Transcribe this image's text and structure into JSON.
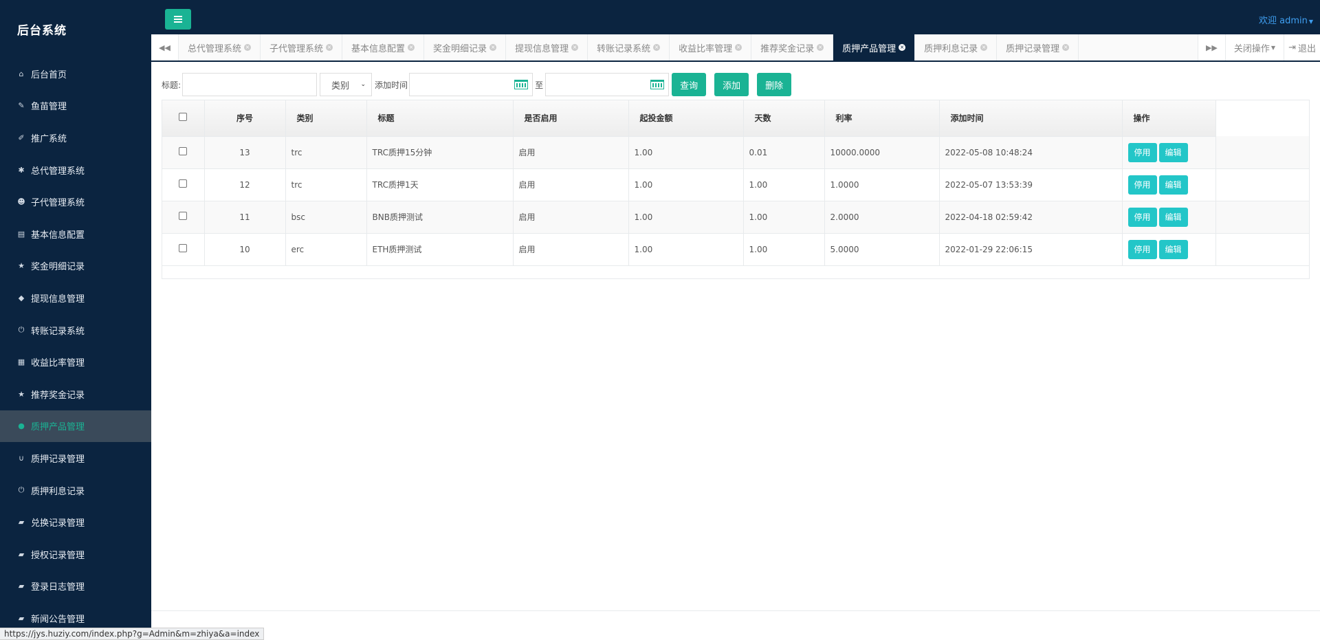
{
  "app": {
    "title": "后台系统"
  },
  "sidebar": {
    "items": [
      {
        "label": "后台首页",
        "icon": "home-icon",
        "glyph": "⌂"
      },
      {
        "label": "鱼苗管理",
        "icon": "wrench-icon",
        "glyph": "✎"
      },
      {
        "label": "推广系统",
        "icon": "edit-icon",
        "glyph": "✐"
      },
      {
        "label": "总代管理系统",
        "icon": "asterisk-icon",
        "glyph": "✱"
      },
      {
        "label": "子代管理系统",
        "icon": "users-icon",
        "glyph": "☻"
      },
      {
        "label": "基本信息配置",
        "icon": "file-icon",
        "glyph": "▤"
      },
      {
        "label": "奖金明细记录",
        "icon": "star-icon",
        "glyph": "★"
      },
      {
        "label": "提现信息管理",
        "icon": "tag-icon",
        "glyph": "◆"
      },
      {
        "label": "转账记录系统",
        "icon": "power-icon",
        "glyph": "⏻"
      },
      {
        "label": "收益比率管理",
        "icon": "calendar-icon",
        "glyph": "▦"
      },
      {
        "label": "推荐奖金记录",
        "icon": "star-icon",
        "glyph": "★"
      },
      {
        "label": "质押产品管理",
        "icon": "comment-icon",
        "glyph": "●"
      },
      {
        "label": "质押记录管理",
        "icon": "magnet-icon",
        "glyph": "∪"
      },
      {
        "label": "质押利息记录",
        "icon": "power-icon",
        "glyph": "⏻"
      },
      {
        "label": "兑换记录管理",
        "icon": "book-icon",
        "glyph": "▰"
      },
      {
        "label": "授权记录管理",
        "icon": "book-icon",
        "glyph": "▰"
      },
      {
        "label": "登录日志管理",
        "icon": "book-icon",
        "glyph": "▰"
      },
      {
        "label": "新闻公告管理",
        "icon": "book-icon",
        "glyph": "▰"
      }
    ],
    "active_index": 11
  },
  "header": {
    "welcome": "欢迎 admin"
  },
  "tabs": {
    "items": [
      {
        "label": "总代管理系统"
      },
      {
        "label": "子代管理系统"
      },
      {
        "label": "基本信息配置"
      },
      {
        "label": "奖金明细记录"
      },
      {
        "label": "提现信息管理"
      },
      {
        "label": "转账记录系统"
      },
      {
        "label": "收益比率管理"
      },
      {
        "label": "推荐奖金记录"
      },
      {
        "label": "质押产品管理"
      },
      {
        "label": "质押利息记录"
      },
      {
        "label": "质押记录管理"
      }
    ],
    "active_index": 8,
    "close_ops": "关闭操作",
    "logout": "退出"
  },
  "filter": {
    "title_label": "标题:",
    "category_placeholder": "类别",
    "add_time_label": "添加时间",
    "to_label": "至",
    "query_button": "查询",
    "add_button": "添加",
    "delete_button": "删除"
  },
  "table": {
    "columns": [
      "序号",
      "类别",
      "标题",
      "是否启用",
      "起投金额",
      "天数",
      "利率",
      "添加时间",
      "操作"
    ],
    "rows": [
      {
        "id": "13",
        "category": "trc",
        "title": "TRC质押15分钟",
        "enabled": "启用",
        "min_amount": "1.00",
        "days": "0.01",
        "rate": "10000.0000",
        "time": "2022-05-08 10:48:24"
      },
      {
        "id": "12",
        "category": "trc",
        "title": "TRC质押1天",
        "enabled": "启用",
        "min_amount": "1.00",
        "days": "1.00",
        "rate": "1.0000",
        "time": "2022-05-07 13:53:39"
      },
      {
        "id": "11",
        "category": "bsc",
        "title": "BNB质押测试",
        "enabled": "启用",
        "min_amount": "1.00",
        "days": "1.00",
        "rate": "2.0000",
        "time": "2022-04-18 02:59:42"
      },
      {
        "id": "10",
        "category": "erc",
        "title": "ETH质押测试",
        "enabled": "启用",
        "min_amount": "1.00",
        "days": "1.00",
        "rate": "5.0000",
        "time": "2022-01-29 22:06:15"
      }
    ],
    "disable_label": "停用",
    "edit_label": "编辑"
  },
  "status_bar": {
    "url": "https://jys.huziy.com/index.php?g=Admin&m=zhiya&a=index"
  },
  "colors": {
    "sidebar_bg": "#0b2440",
    "accent": "#1ab394",
    "info": "#23c6c8"
  }
}
